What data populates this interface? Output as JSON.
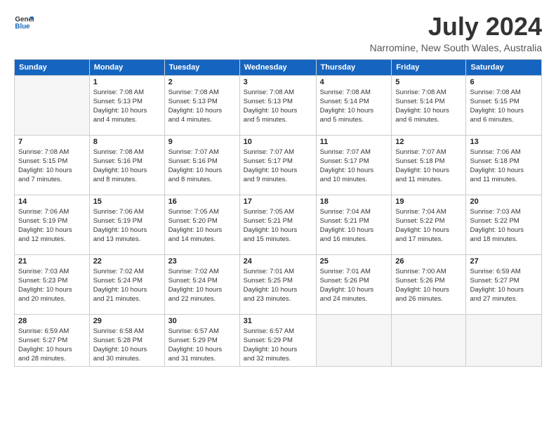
{
  "header": {
    "logo_general": "General",
    "logo_blue": "Blue",
    "title": "July 2024",
    "location": "Narromine, New South Wales, Australia"
  },
  "days_of_week": [
    "Sunday",
    "Monday",
    "Tuesday",
    "Wednesday",
    "Thursday",
    "Friday",
    "Saturday"
  ],
  "weeks": [
    [
      {
        "day": "",
        "info": ""
      },
      {
        "day": "1",
        "info": "Sunrise: 7:08 AM\nSunset: 5:13 PM\nDaylight: 10 hours\nand 4 minutes."
      },
      {
        "day": "2",
        "info": "Sunrise: 7:08 AM\nSunset: 5:13 PM\nDaylight: 10 hours\nand 4 minutes."
      },
      {
        "day": "3",
        "info": "Sunrise: 7:08 AM\nSunset: 5:13 PM\nDaylight: 10 hours\nand 5 minutes."
      },
      {
        "day": "4",
        "info": "Sunrise: 7:08 AM\nSunset: 5:14 PM\nDaylight: 10 hours\nand 5 minutes."
      },
      {
        "day": "5",
        "info": "Sunrise: 7:08 AM\nSunset: 5:14 PM\nDaylight: 10 hours\nand 6 minutes."
      },
      {
        "day": "6",
        "info": "Sunrise: 7:08 AM\nSunset: 5:15 PM\nDaylight: 10 hours\nand 6 minutes."
      }
    ],
    [
      {
        "day": "7",
        "info": "Sunrise: 7:08 AM\nSunset: 5:15 PM\nDaylight: 10 hours\nand 7 minutes."
      },
      {
        "day": "8",
        "info": "Sunrise: 7:08 AM\nSunset: 5:16 PM\nDaylight: 10 hours\nand 8 minutes."
      },
      {
        "day": "9",
        "info": "Sunrise: 7:07 AM\nSunset: 5:16 PM\nDaylight: 10 hours\nand 8 minutes."
      },
      {
        "day": "10",
        "info": "Sunrise: 7:07 AM\nSunset: 5:17 PM\nDaylight: 10 hours\nand 9 minutes."
      },
      {
        "day": "11",
        "info": "Sunrise: 7:07 AM\nSunset: 5:17 PM\nDaylight: 10 hours\nand 10 minutes."
      },
      {
        "day": "12",
        "info": "Sunrise: 7:07 AM\nSunset: 5:18 PM\nDaylight: 10 hours\nand 11 minutes."
      },
      {
        "day": "13",
        "info": "Sunrise: 7:06 AM\nSunset: 5:18 PM\nDaylight: 10 hours\nand 11 minutes."
      }
    ],
    [
      {
        "day": "14",
        "info": "Sunrise: 7:06 AM\nSunset: 5:19 PM\nDaylight: 10 hours\nand 12 minutes."
      },
      {
        "day": "15",
        "info": "Sunrise: 7:06 AM\nSunset: 5:19 PM\nDaylight: 10 hours\nand 13 minutes."
      },
      {
        "day": "16",
        "info": "Sunrise: 7:05 AM\nSunset: 5:20 PM\nDaylight: 10 hours\nand 14 minutes."
      },
      {
        "day": "17",
        "info": "Sunrise: 7:05 AM\nSunset: 5:21 PM\nDaylight: 10 hours\nand 15 minutes."
      },
      {
        "day": "18",
        "info": "Sunrise: 7:04 AM\nSunset: 5:21 PM\nDaylight: 10 hours\nand 16 minutes."
      },
      {
        "day": "19",
        "info": "Sunrise: 7:04 AM\nSunset: 5:22 PM\nDaylight: 10 hours\nand 17 minutes."
      },
      {
        "day": "20",
        "info": "Sunrise: 7:03 AM\nSunset: 5:22 PM\nDaylight: 10 hours\nand 18 minutes."
      }
    ],
    [
      {
        "day": "21",
        "info": "Sunrise: 7:03 AM\nSunset: 5:23 PM\nDaylight: 10 hours\nand 20 minutes."
      },
      {
        "day": "22",
        "info": "Sunrise: 7:02 AM\nSunset: 5:24 PM\nDaylight: 10 hours\nand 21 minutes."
      },
      {
        "day": "23",
        "info": "Sunrise: 7:02 AM\nSunset: 5:24 PM\nDaylight: 10 hours\nand 22 minutes."
      },
      {
        "day": "24",
        "info": "Sunrise: 7:01 AM\nSunset: 5:25 PM\nDaylight: 10 hours\nand 23 minutes."
      },
      {
        "day": "25",
        "info": "Sunrise: 7:01 AM\nSunset: 5:26 PM\nDaylight: 10 hours\nand 24 minutes."
      },
      {
        "day": "26",
        "info": "Sunrise: 7:00 AM\nSunset: 5:26 PM\nDaylight: 10 hours\nand 26 minutes."
      },
      {
        "day": "27",
        "info": "Sunrise: 6:59 AM\nSunset: 5:27 PM\nDaylight: 10 hours\nand 27 minutes."
      }
    ],
    [
      {
        "day": "28",
        "info": "Sunrise: 6:59 AM\nSunset: 5:27 PM\nDaylight: 10 hours\nand 28 minutes."
      },
      {
        "day": "29",
        "info": "Sunrise: 6:58 AM\nSunset: 5:28 PM\nDaylight: 10 hours\nand 30 minutes."
      },
      {
        "day": "30",
        "info": "Sunrise: 6:57 AM\nSunset: 5:29 PM\nDaylight: 10 hours\nand 31 minutes."
      },
      {
        "day": "31",
        "info": "Sunrise: 6:57 AM\nSunset: 5:29 PM\nDaylight: 10 hours\nand 32 minutes."
      },
      {
        "day": "",
        "info": ""
      },
      {
        "day": "",
        "info": ""
      },
      {
        "day": "",
        "info": ""
      }
    ]
  ]
}
